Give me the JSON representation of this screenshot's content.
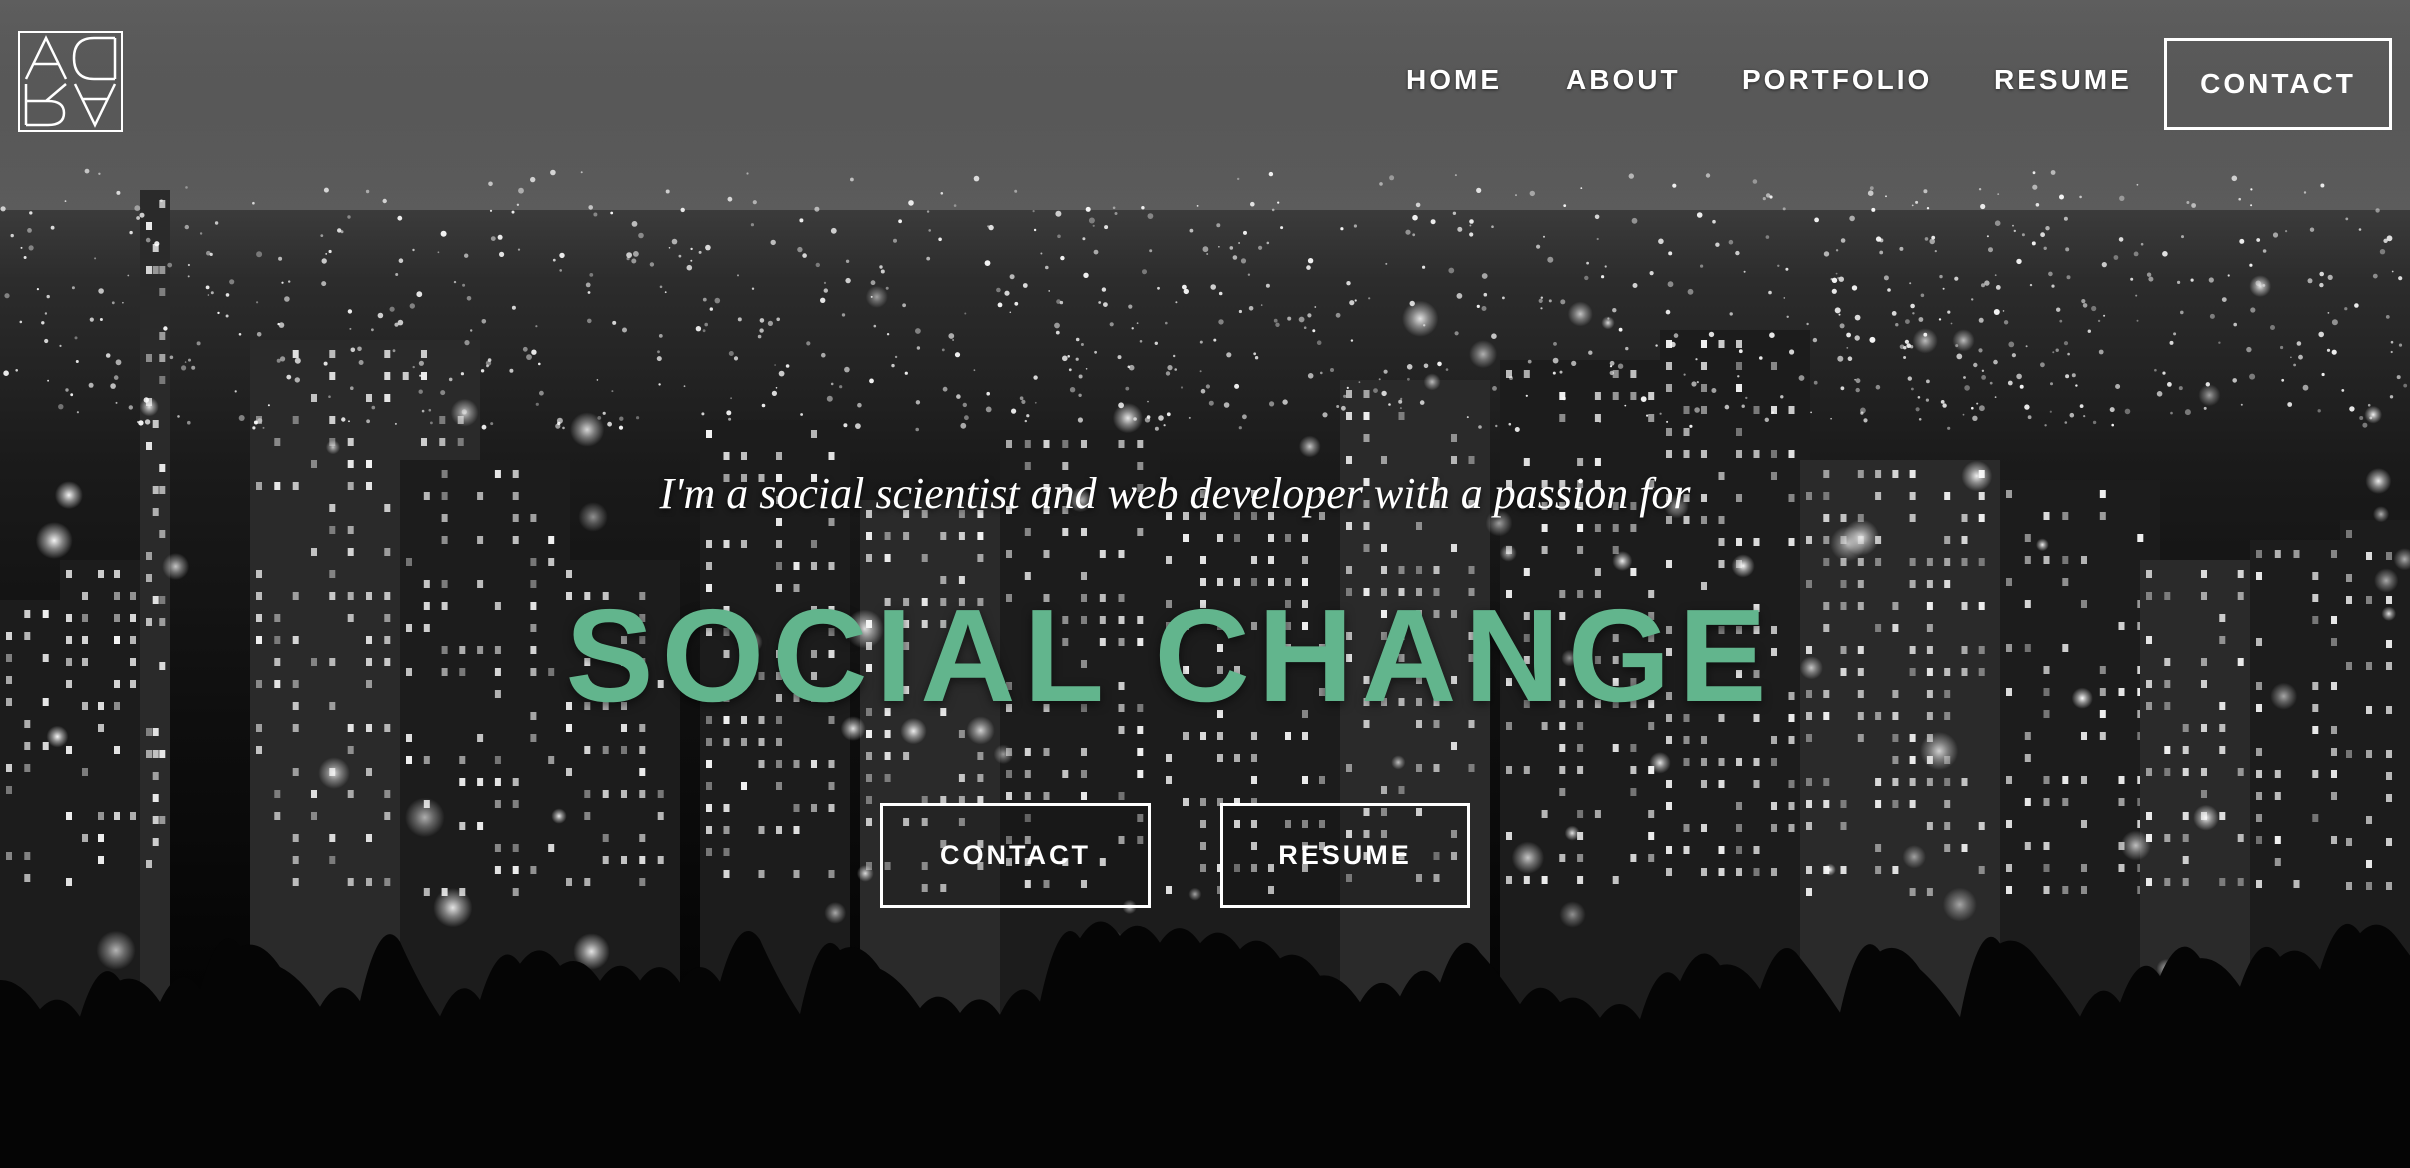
{
  "site": {
    "logo_text": "ADRA"
  },
  "nav": {
    "items": [
      {
        "label": "HOME"
      },
      {
        "label": "ABOUT"
      },
      {
        "label": "PORTFOLIO"
      },
      {
        "label": "RESUME"
      }
    ],
    "contact_label": "CONTACT"
  },
  "hero": {
    "tagline": "I'm a social scientist and web developer with a passion for",
    "headline": "SOCIAL CHANGE",
    "headline_color": "#62b58d",
    "buttons": {
      "contact_label": "CONTACT",
      "resume_label": "RESUME"
    },
    "background": "night-city-skyline-photo"
  }
}
